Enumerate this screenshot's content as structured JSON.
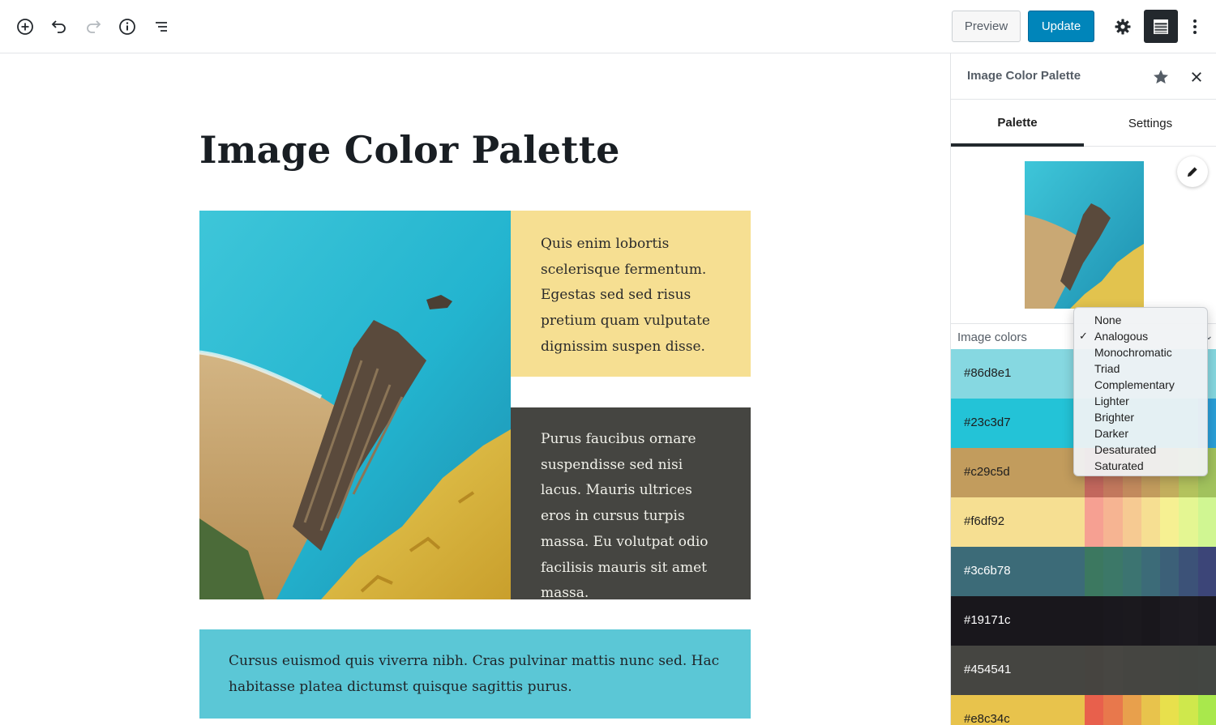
{
  "toolbar": {
    "icons": [
      "add-block-icon",
      "undo-icon",
      "redo-icon",
      "info-icon",
      "block-navigation-icon",
      "settings-gear-icon",
      "sidebar-toggle-icon",
      "more-menu-icon"
    ],
    "preview_label": "Preview",
    "update_label": "Update",
    "accent_color": "#0085ba"
  },
  "editor": {
    "title": "Image Color Palette",
    "cards": {
      "yellow": {
        "text": "Quis enim lobortis scelerisque fermentum. Egestas sed sed risus pretium quam vulputate dignissim suspen disse.",
        "background": "#f6df92"
      },
      "dark": {
        "text": "Purus faucibus ornare suspendisse sed nisi lacus. Mauris ultrices eros in cursus turpis massa. Eu volutpat odio facilisis mauris sit amet massa.",
        "background": "#454541"
      },
      "teal": {
        "text": "Cursus euismod quis viverra nibh. Cras pulvinar mattis nunc sed. Hac habitasse platea dictumst quisque sagittis purus.",
        "background": "#5bc7d6"
      }
    }
  },
  "sidebar": {
    "title": "Image Color Palette",
    "tabs": [
      {
        "label": "Palette",
        "active": true
      },
      {
        "label": "Settings",
        "active": false
      }
    ],
    "image_colors_label": "Image colors",
    "swatches": [
      {
        "hex": "#86d8e1",
        "text_color": "#1e1e1e",
        "variants": [
          "#8fdbe3",
          "#86d8e1",
          "#86d8e1",
          "#86d8e1",
          "#86d8e1",
          "#86d8e1",
          "#86d8e1"
        ]
      },
      {
        "hex": "#23c3d7",
        "text_color": "#1e1e1e",
        "variants": [
          "#23c3d7",
          "#23c3d7",
          "#23c3d7",
          "#23c3d7",
          "#23c3d7",
          "#23c3d7",
          "#2a9fd9"
        ]
      },
      {
        "hex": "#c29c5d",
        "text_color": "#1e1e1e",
        "variants": [
          "#c2675d",
          "#c2785d",
          "#c28a5d",
          "#c29c5d",
          "#c2ae5d",
          "#b3c25d",
          "#a1c25d"
        ]
      },
      {
        "hex": "#f6df92",
        "text_color": "#1e1e1e",
        "variants": [
          "#f6a092",
          "#f6b492",
          "#f6ca92",
          "#f6df92",
          "#f6f092",
          "#e4f692",
          "#d0f692"
        ]
      },
      {
        "hex": "#3c6b78",
        "text_color": "#ffffff",
        "variants": [
          "#3c7860",
          "#3c7868",
          "#3c7471",
          "#3c6b78",
          "#3c6078",
          "#3c5278",
          "#3c4578"
        ]
      },
      {
        "hex": "#19171c",
        "text_color": "#ffffff",
        "variants": [
          "#19171c",
          "#1a181e",
          "#1b191e",
          "#19171c",
          "#1c1a20",
          "#1d1b21",
          "#1b191f"
        ]
      },
      {
        "hex": "#454541",
        "text_color": "#ffffff",
        "variants": [
          "#464440",
          "#474642",
          "#454541",
          "#454541",
          "#444541",
          "#434541",
          "#434642"
        ]
      },
      {
        "hex": "#e8c34c",
        "text_color": "#1e1e1e",
        "variants": [
          "#e8604c",
          "#e8784c",
          "#e8a04c",
          "#e8c34c",
          "#e8e04c",
          "#cfe84c",
          "#a9e84c"
        ]
      }
    ]
  },
  "menu": {
    "selected": "Analogous",
    "options": [
      "None",
      "Analogous",
      "Monochromatic",
      "Triad",
      "Complementary",
      "Lighter",
      "Brighter",
      "Darker",
      "Desaturated",
      "Saturated"
    ]
  }
}
